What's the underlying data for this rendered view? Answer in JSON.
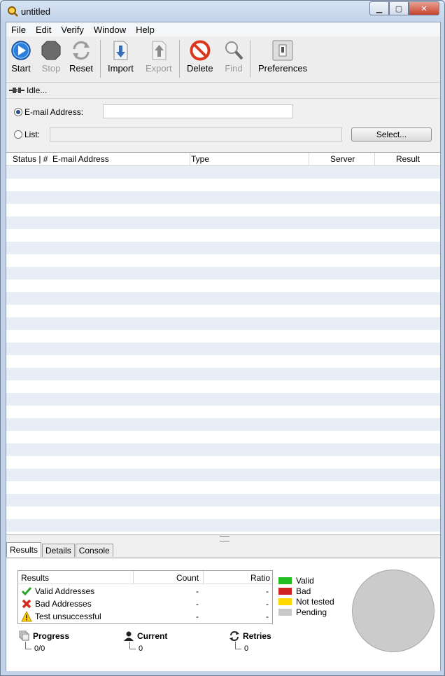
{
  "window": {
    "title": "untitled",
    "minimize_icon": "minimize-icon",
    "maximize_icon": "maximize-icon",
    "close_icon": "close-icon"
  },
  "menu": [
    "File",
    "Edit",
    "Verify",
    "Window",
    "Help"
  ],
  "toolbar": {
    "start": {
      "label": "Start",
      "icon": "play-icon"
    },
    "stop": {
      "label": "Stop",
      "icon": "stop-icon"
    },
    "reset": {
      "label": "Reset",
      "icon": "reset-arrows-icon"
    },
    "import": {
      "label": "Import",
      "icon": "import-icon"
    },
    "export": {
      "label": "Export",
      "icon": "export-icon"
    },
    "delete": {
      "label": "Delete",
      "icon": "delete-icon"
    },
    "find": {
      "label": "Find",
      "icon": "magnifier-icon"
    },
    "preferences": {
      "label": "Preferences",
      "icon": "switch-icon"
    }
  },
  "status": {
    "text": "Idle...",
    "icon": "plug-icon"
  },
  "input": {
    "email_label": "E-mail Address:",
    "email_value": "",
    "list_label": "List:",
    "list_value": "",
    "select_button": "Select..."
  },
  "table": {
    "columns": [
      "Status | #",
      "E-mail Address",
      "Type",
      "Server",
      "Result"
    ]
  },
  "tabs": [
    "Results",
    "Details",
    "Console"
  ],
  "results": {
    "columns": [
      "Results",
      "Count",
      "Ratio"
    ],
    "rows": [
      {
        "label": "Valid Addresses",
        "count": "-",
        "ratio": "-",
        "icon": "check-icon"
      },
      {
        "label": "Bad Addresses",
        "count": "-",
        "ratio": "-",
        "icon": "x-icon"
      },
      {
        "label": "Test unsuccessful",
        "count": "-",
        "ratio": "-",
        "icon": "warning-icon"
      }
    ]
  },
  "legend": [
    {
      "label": "Valid",
      "color": "#22bb22"
    },
    {
      "label": "Bad",
      "color": "#cc2222"
    },
    {
      "label": "Not tested",
      "color": "#ffd700"
    },
    {
      "label": "Pending",
      "color": "#c8c8c8"
    }
  ],
  "stats": {
    "progress": {
      "label": "Progress",
      "value": "0/0"
    },
    "current": {
      "label": "Current",
      "value": "0"
    },
    "retries": {
      "label": "Retries",
      "value": "0"
    }
  }
}
